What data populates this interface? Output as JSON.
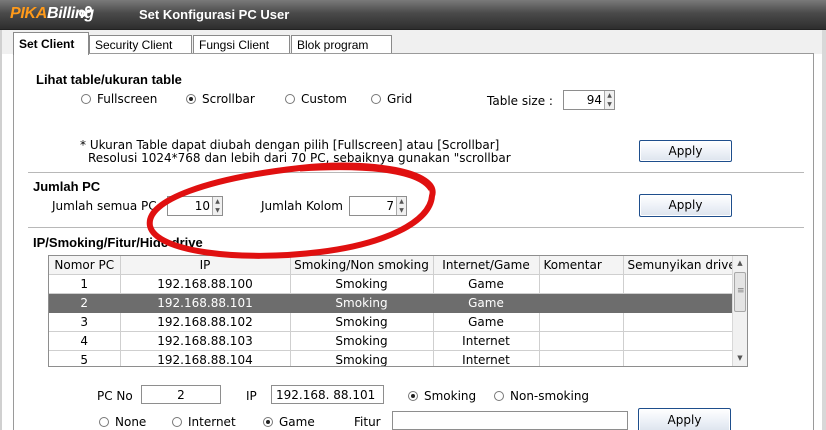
{
  "app": {
    "logo_part1": "PIKA",
    "logo_part2": "Billing",
    "window_title": "Set Konfigurasi PC User"
  },
  "tabs": [
    "Set Client",
    "Security Client",
    "Fungsi Client",
    "Blok program"
  ],
  "table_view": {
    "heading": "Lihat table/ukuran table",
    "options": [
      "Fullscreen",
      "Scrollbar",
      "Custom",
      "Grid"
    ],
    "selected": "Scrollbar",
    "table_size_label": "Table size :",
    "table_size_value": "94",
    "note_line1": "* Ukuran Table dapat diubah dengan pilih [Fullscreen] atau [Scrollbar]",
    "note_line2": "Resolusi 1024*768 dan lebih dari 70 PC, sebaiknya gunakan \"scrollbar",
    "apply_label": "Apply"
  },
  "jumlah_pc": {
    "heading": "Jumlah PC",
    "semua_label": "Jumlah semua PC",
    "semua_value": "10",
    "kolom_label": "Jumlah Kolom",
    "kolom_value": "7",
    "apply_label": "Apply"
  },
  "ip_section": {
    "heading": "IP/Smoking/Fitur/Hide drive",
    "columns": [
      "Nomor PC",
      "IP",
      "Smoking/Non smoking",
      "Internet/Game",
      "Komentar",
      "Semunyikan drive"
    ],
    "rows": [
      [
        "1",
        "192.168.88.100",
        "Smoking",
        "Game",
        "",
        ""
      ],
      [
        "2",
        "192.168.88.101",
        "Smoking",
        "Game",
        "",
        ""
      ],
      [
        "3",
        "192.168.88.102",
        "Smoking",
        "Game",
        "",
        ""
      ],
      [
        "4",
        "192.168.88.103",
        "Smoking",
        "Internet",
        "",
        ""
      ],
      [
        "5",
        "192.168.88.104",
        "Smoking",
        "Internet",
        "",
        ""
      ]
    ],
    "selected_row": 1
  },
  "edit": {
    "pc_no_label": "PC No",
    "pc_no_value": "2",
    "ip_label": "IP",
    "ip_value": "192.168.  88.101",
    "smoking_options": [
      "Smoking",
      "Non-smoking"
    ],
    "smoking_selected": "Smoking",
    "mode_options": [
      "None",
      "Internet",
      "Game"
    ],
    "mode_selected": "Game",
    "fitur_label": "Fitur",
    "fitur_value": "",
    "apply_label": "Apply"
  },
  "colors": {
    "annotation_ellipse": "#e01010",
    "button_border": "#1e4e8c",
    "selected_row": "#6d6d6d",
    "logo_accent": "#ff9a1a"
  }
}
